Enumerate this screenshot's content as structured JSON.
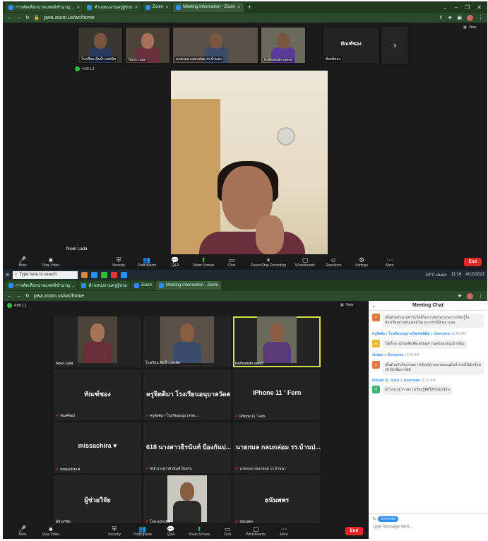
{
  "screen1": {
    "browser": {
      "tabs": [
        {
          "label": "การคัดเลือกนายแพทย์ชำนาญ…",
          "active": false
        },
        {
          "label": "ตำแหน่งงานครูผู้ช่วย",
          "active": false
        },
        {
          "label": "Zoom",
          "active": false
        },
        {
          "label": "Meeting Information - Zoom",
          "active": true
        }
      ],
      "url": "pwa.zoom.us/wc/home",
      "view_label": "View"
    },
    "meeting_meta": {
      "status": "4:00  1.1"
    },
    "thumbnails": [
      {
        "name": "โรงเรียน คุ้มน้ำ เทคนิค",
        "type": "video"
      },
      {
        "name": "Noon Lada",
        "type": "video"
      },
      {
        "name": "นายกมล กลมกล่อม รร.บ้านนา",
        "type": "video"
      },
      {
        "name": "kruthamath saeed",
        "type": "video"
      },
      {
        "name": "ทัณฑ์ชอง",
        "type": "name",
        "subname": "ทัณฑ์ชอง"
      }
    ],
    "speaker_label": "Noon Lada",
    "toolbar": {
      "items": [
        {
          "label": "Mute",
          "icon": "mic-icon"
        },
        {
          "label": "Stop Video",
          "icon": "video-icon"
        },
        {
          "label": "Security",
          "icon": "shield-icon"
        },
        {
          "label": "Participants",
          "icon": "participants-icon",
          "count": "12"
        },
        {
          "label": "Q&A",
          "icon": "qa-icon"
        },
        {
          "label": "Share Screen",
          "icon": "share-icon"
        },
        {
          "label": "Chat",
          "icon": "chat-icon"
        },
        {
          "label": "Pause/Stop Recording",
          "icon": "record-icon"
        },
        {
          "label": "Whiteboards",
          "icon": "whiteboard-icon"
        },
        {
          "label": "Reactions",
          "icon": "reaction-icon"
        },
        {
          "label": "Settings",
          "icon": "gear-icon"
        },
        {
          "label": "More",
          "icon": "more-icon"
        }
      ],
      "end_label": "End"
    },
    "taskbar": {
      "search_placeholder": "Type here to search",
      "weather": "34°C ฝนตก",
      "time": "11:16",
      "date": "4/12/2021"
    }
  },
  "screen2": {
    "browser": {
      "tabs": [
        {
          "label": "การคัดเลือกนายแพทย์ชำนาญ…",
          "active": false
        },
        {
          "label": "ตำแหน่งงานครูผู้ช่วย",
          "active": false
        },
        {
          "label": "Zoom",
          "active": false
        },
        {
          "label": "Meeting Information - Zoom",
          "active": true
        }
      ],
      "url": "pwa.zoom.us/wc/home",
      "view_label": "View"
    },
    "meeting_meta": {
      "status": "4:00  1.1"
    },
    "grid": [
      {
        "type": "video",
        "label": "Noon Lada",
        "center": ""
      },
      {
        "type": "video",
        "label": "โรงเรียน คุ้มน้ำ เทคนิค",
        "center": ""
      },
      {
        "type": "video",
        "label": "kruthamath saeed",
        "center": "",
        "active": true
      },
      {
        "type": "name",
        "label": "ทัณฑ์ชอง",
        "center": "ทัณฑ์ชอง"
      },
      {
        "type": "name",
        "label": "ครูจิตติมา โรงเรียนอนุบาลวัดเ…",
        "center": "ครูจิตติมา โรงเรียนอนุบาลวัดต..."
      },
      {
        "type": "name",
        "label": "iPhone 11 ' Fern",
        "center": "iPhone 11 ' Fern"
      },
      {
        "type": "name",
        "label": "missachira ♥",
        "center": "missachira ♥"
      },
      {
        "type": "name",
        "label": "618 นางสาวธิรนันท์ ป้องกัน",
        "center": "618 นางสาวธิรนันท์ ป้องกันป..."
      },
      {
        "type": "name",
        "label": "นายกมล กลมกล่อม รร.บ้านนา",
        "center": "นายกมล กลมกล่อม รร.บ้านป..."
      },
      {
        "type": "name",
        "label": "ผู้ช่วยวิจัย",
        "center": "ผู้ช่วยวิจัย"
      },
      {
        "type": "video",
        "label": "โจม อมักรดิษ",
        "center": ""
      },
      {
        "type": "name",
        "label": "ธนันพพร",
        "center": "ธนันพพร"
      }
    ],
    "chat": {
      "title": "Meeting Chat",
      "messages": [
        {
          "avatar": "ก",
          "color": "#e07a3a",
          "sender": "",
          "to": "",
          "time": "",
          "text": "เห็นด้วยกับนายทำไม่ได้ดีในการจัดกิจกรรมการเรียนรู้ในห้องเรียนผ่านอินเทอร์เน็ต ควรปรับให้เหมาะสม"
        },
        {
          "avatar": "คจ",
          "color": "#e8b923",
          "sender": "ครูจิตติมา โรงเรียนอนุบาลวัดเทพนิมิต",
          "to": "Everyone",
          "time": "11:08 AM",
          "text": "ให้เด็กอ่านหนังสือเพื่อเตรียมความพร้อมก่อนเข้าเรียน"
        },
        {
          "avatar": "ก",
          "color": "#e07a3a",
          "sender": "กับชอง",
          "to": "Everyone",
          "time": "11:10 AM",
          "text": "เห็นด้วยกับกิจกรรมการเรียนรู้ผ่านระบบออนไลน์ ช่วยให้นักเรียนเข้าถึงเนื้อหาได้ดี"
        },
        {
          "avatar": "I1",
          "color": "#3cb371",
          "sender": "iPhone 11 ' Fern",
          "to": "Everyone",
          "time": "11:10 AM",
          "text": "สร้างบรรยากาศการเรียนรู้ที่ดีให้กับนักเรียน"
        }
      ],
      "to_label": "To:",
      "to_value": "Everyone",
      "input_placeholder": "Type message here..."
    },
    "toolbar": {
      "items": [
        {
          "label": "Mute",
          "icon": "mic-icon"
        },
        {
          "label": "Stop Video",
          "icon": "video-icon"
        },
        {
          "label": "Security",
          "icon": "shield-icon"
        },
        {
          "label": "Participants",
          "icon": "participants-icon",
          "count": "12"
        },
        {
          "label": "Q&A",
          "icon": "qa-icon"
        },
        {
          "label": "Share Screen",
          "icon": "share-icon"
        },
        {
          "label": "Chat",
          "icon": "chat-icon"
        },
        {
          "label": "Whiteboards",
          "icon": "whiteboard-icon"
        },
        {
          "label": "More",
          "icon": "more-icon"
        }
      ],
      "end_label": "End"
    }
  }
}
